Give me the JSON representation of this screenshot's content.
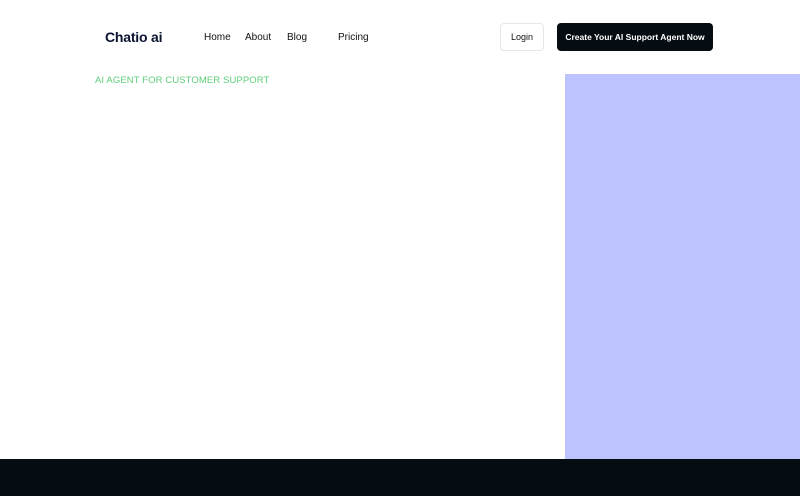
{
  "brand": {
    "logo_text": "Chatio ai"
  },
  "nav": {
    "items": [
      {
        "label": "Home"
      },
      {
        "label": "About"
      },
      {
        "label": "Blog"
      },
      {
        "label": "Pricing"
      }
    ]
  },
  "header_actions": {
    "login_label": "Login",
    "cta_label": "Create Your AI Support Agent Now"
  },
  "hero": {
    "eyebrow": "AI AGENT FOR CUSTOMER SUPPORT"
  },
  "colors": {
    "accent_green": "#5fcf7a",
    "panel_lavender": "#bcc3ff",
    "dark": "#050d12",
    "brand_navy": "#0b1230"
  }
}
